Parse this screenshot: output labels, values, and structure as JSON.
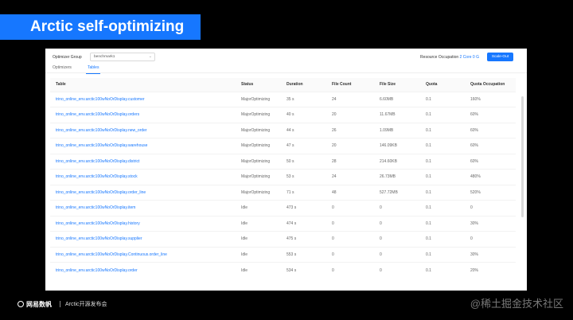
{
  "slide": {
    "title": "Arctic self-optimizing",
    "footer_brand": "网易数帆",
    "footer_event": "Arctic开源发布会",
    "watermark": "@稀土掘金技术社区"
  },
  "toolbar": {
    "optimizer_group_label": "Optimizer Group",
    "optimizer_group_value": "benchmark1",
    "resource_occupation_label": "Resource Occupation",
    "resource_occupation_value": "2 Core 0 G",
    "scale_out_label": "Scale-Out"
  },
  "tabs": [
    {
      "label": "Optimizers",
      "active": false
    },
    {
      "label": "Tables",
      "active": true
    }
  ],
  "table": {
    "columns": [
      "Table",
      "Status",
      "Duration",
      "File Count",
      "File Size",
      "Quota",
      "Quota Occupation"
    ],
    "rows": [
      [
        "trino_online_env.arctic100wNoOrDisplay.customer",
        "MajorOptimizing",
        "35 s",
        "24",
        "6.60MB",
        "0.1",
        "160%"
      ],
      [
        "trino_online_env.arctic100wNoOrDisplay.orders",
        "MajorOptimizing",
        "40 s",
        "20",
        "11.67MB",
        "0.1",
        "60%"
      ],
      [
        "trino_online_env.arctic100wNoOrDisplay.new_order",
        "MajorOptimizing",
        "44 s",
        "26",
        "1.09MB",
        "0.1",
        "60%"
      ],
      [
        "trino_online_env.arctic100wNoOrDisplay.warehouse",
        "MajorOptimizing",
        "47 s",
        "20",
        "146.09KB",
        "0.1",
        "60%"
      ],
      [
        "trino_online_env.arctic100wNoOrDisplay.district",
        "MajorOptimizing",
        "50 s",
        "28",
        "214.60KB",
        "0.1",
        "60%"
      ],
      [
        "trino_online_env.arctic100wNoOrDisplay.stock",
        "MajorOptimizing",
        "53 s",
        "24",
        "26.73MB",
        "0.1",
        "480%"
      ],
      [
        "trino_online_env.arctic100wNoOrDisplay.order_line",
        "MajorOptimizing",
        "71 s",
        "48",
        "527.72MB",
        "0.1",
        "520%"
      ],
      [
        "trino_online_env.arctic100wNoOrDisplay.item",
        "Idle",
        "473 s",
        "0",
        "0",
        "0.1",
        "0"
      ],
      [
        "trino_online_env.arctic100wNoOrDisplay.history",
        "Idle",
        "474 s",
        "0",
        "0",
        "0.1",
        "30%"
      ],
      [
        "trino_online_env.arctic100wNoOrDisplay.supplier",
        "Idle",
        "475 s",
        "0",
        "0",
        "0.1",
        "0"
      ],
      [
        "trino_online_env.arctic100wNoOrDisplay.Continuous.order_line",
        "Idle",
        "553 s",
        "0",
        "0",
        "0.1",
        "30%"
      ],
      [
        "trino_online_env.arctic100wNoOrDisplay.order",
        "Idle",
        "534 s",
        "0",
        "0",
        "0.1",
        "20%"
      ]
    ]
  },
  "colors": {
    "accent": "#1677ff",
    "background": "#000000",
    "panel": "#ffffff"
  }
}
